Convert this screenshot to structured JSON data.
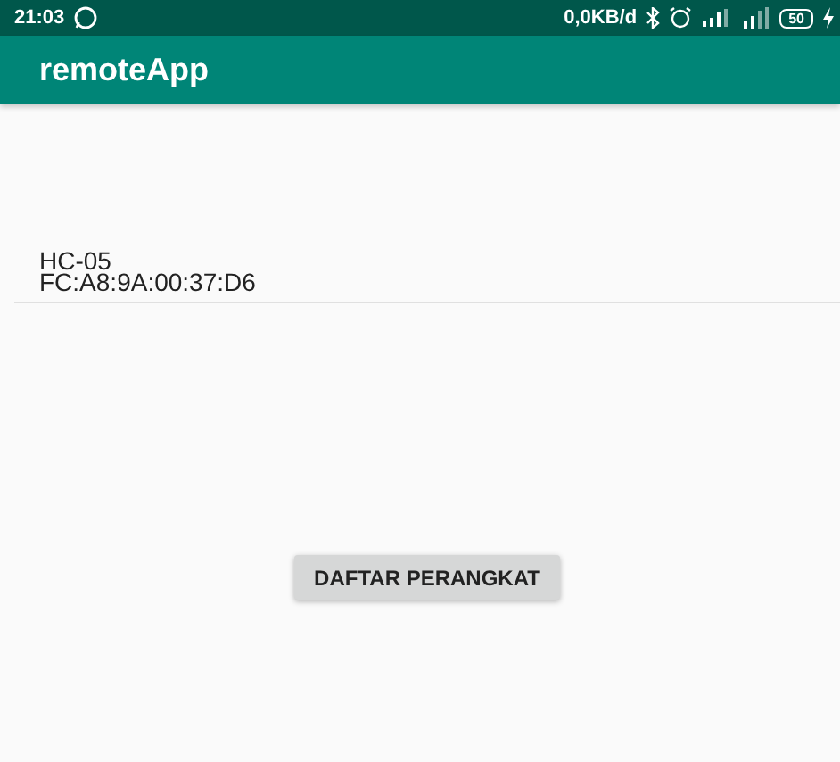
{
  "status_bar": {
    "time": "21:03",
    "data_rate": "0,0KB/d",
    "battery": "50"
  },
  "app_bar": {
    "title": "remoteApp"
  },
  "devices": [
    {
      "name": "HC-05",
      "address": "FC:A8:9A:00:37:D6"
    }
  ],
  "button": {
    "label": "DAFTAR PERANGKAT"
  }
}
